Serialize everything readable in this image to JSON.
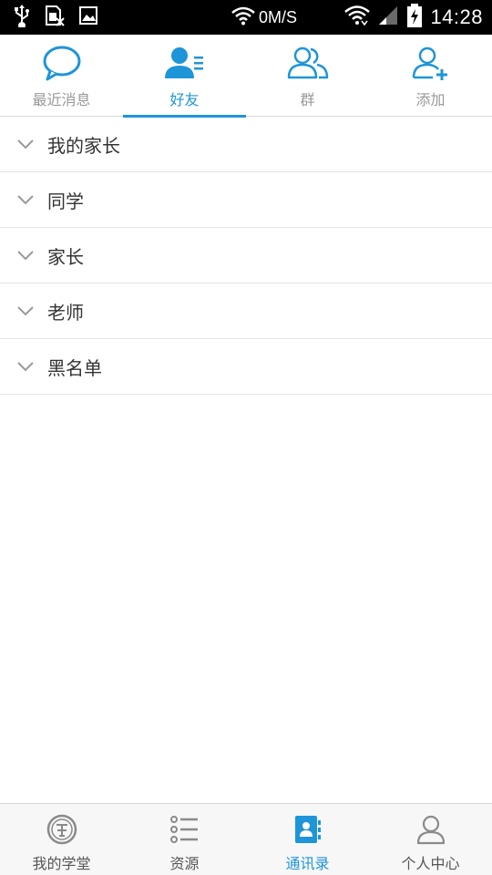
{
  "status_bar": {
    "network_speed": "0M/S",
    "time": "14:28",
    "icons": [
      "usb-icon",
      "no-sim-icon",
      "image-icon",
      "wifi-icon",
      "signal-icon",
      "battery-charging-icon"
    ]
  },
  "top_tabs": [
    {
      "label": "最近消息",
      "icon": "chat-bubble-icon",
      "active": false
    },
    {
      "label": "好友",
      "icon": "friend-list-icon",
      "active": true
    },
    {
      "label": "群",
      "icon": "group-icon",
      "active": false
    },
    {
      "label": "添加",
      "icon": "add-user-icon",
      "active": false
    }
  ],
  "groups": [
    {
      "label": "我的家长"
    },
    {
      "label": "同学"
    },
    {
      "label": "家长"
    },
    {
      "label": "老师"
    },
    {
      "label": "黑名单"
    }
  ],
  "bottom_nav": [
    {
      "label": "我的学堂",
      "icon": "school-seal-icon",
      "active": false
    },
    {
      "label": "资源",
      "icon": "list-icon",
      "active": false
    },
    {
      "label": "通讯录",
      "icon": "contacts-book-icon",
      "active": true
    },
    {
      "label": "个人中心",
      "icon": "person-icon",
      "active": false
    }
  ],
  "colors": {
    "accent": "#1e95d8",
    "inactive_text": "#999999",
    "divider": "#e3e3e3",
    "status_bar_bg": "#000000"
  }
}
